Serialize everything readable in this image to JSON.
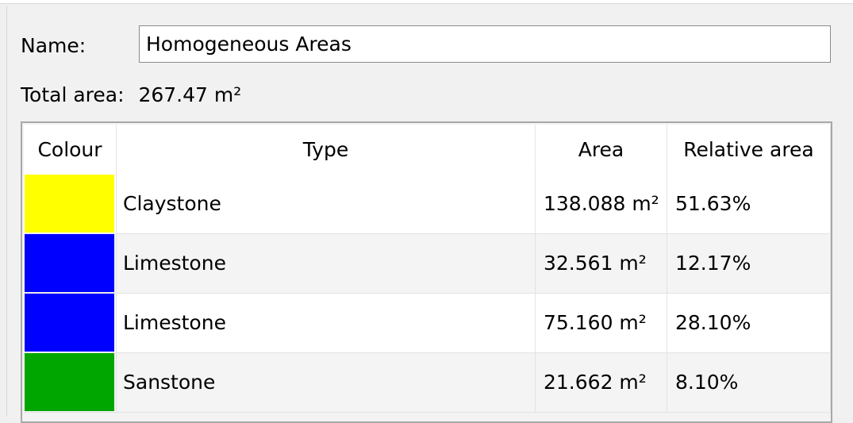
{
  "form": {
    "name_label": "Name:",
    "name_value": "Homogeneous Areas",
    "total_label": "Total area:",
    "total_value": "267.47 m²"
  },
  "table": {
    "headers": {
      "colour": "Colour",
      "type": "Type",
      "area": "Area",
      "relative_area": "Relative area"
    },
    "rows": [
      {
        "colour": "#ffff00",
        "type": "Claystone",
        "area": "138.088 m²",
        "relative_area": "51.63%"
      },
      {
        "colour": "#0000ff",
        "type": "Limestone",
        "area": "32.561 m²",
        "relative_area": "12.17%"
      },
      {
        "colour": "#0000ff",
        "type": "Limestone",
        "area": "75.160 m²",
        "relative_area": "28.10%"
      },
      {
        "colour": "#00a600",
        "type": "Sanstone",
        "area": "21.662 m²",
        "relative_area": "8.10%"
      }
    ]
  }
}
